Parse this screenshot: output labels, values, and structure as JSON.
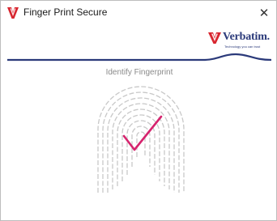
{
  "window": {
    "title": "Finger Print Secure",
    "close_glyph": "✕",
    "app_icon": "verbatim-v-icon"
  },
  "brand": {
    "name": "Verbatim.",
    "tagline": "Technology you can trust",
    "colors": {
      "navy": "#2b3a7a",
      "red": "#d8262f"
    }
  },
  "main": {
    "prompt": "Identify Fingerprint",
    "fingerprint_icon": "fingerprint-icon",
    "check_icon": "checkmark-icon",
    "check_color": "#d6246e",
    "ridge_color": "#c8c8c8"
  }
}
